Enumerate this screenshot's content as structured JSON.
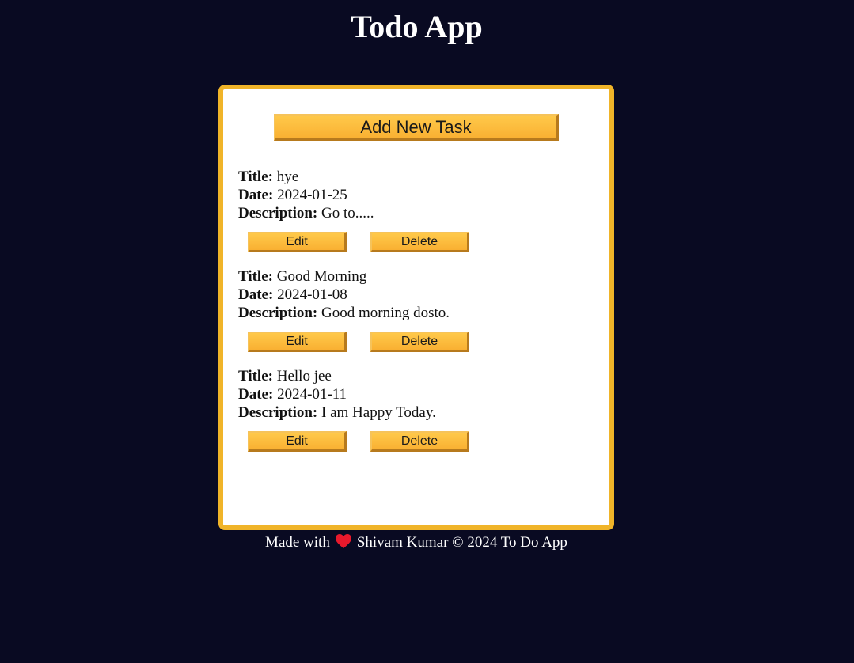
{
  "header": {
    "title": "Todo App"
  },
  "toolbar": {
    "add_label": "Add New Task"
  },
  "labels": {
    "title": "Title:",
    "date": "Date:",
    "description": "Description:"
  },
  "tasks": [
    {
      "title": "hye",
      "date": "2024-01-25",
      "description": "Go to.....",
      "edit_label": "Edit",
      "delete_label": "Delete"
    },
    {
      "title": "Good Morning",
      "date": "2024-01-08",
      "description": "Good morning dosto.",
      "edit_label": "Edit",
      "delete_label": "Delete"
    },
    {
      "title": "Hello jee",
      "date": "2024-01-11",
      "description": "I am Happy Today.",
      "edit_label": "Edit",
      "delete_label": "Delete"
    }
  ],
  "footer": {
    "prefix": "Made with",
    "heart_icon": "heart-icon",
    "suffix": "Shivam Kumar © 2024 To Do App"
  },
  "colors": {
    "background": "#090a22",
    "card_border": "#f0b429",
    "button": "#ffc14a",
    "heart": "#e8192c"
  }
}
